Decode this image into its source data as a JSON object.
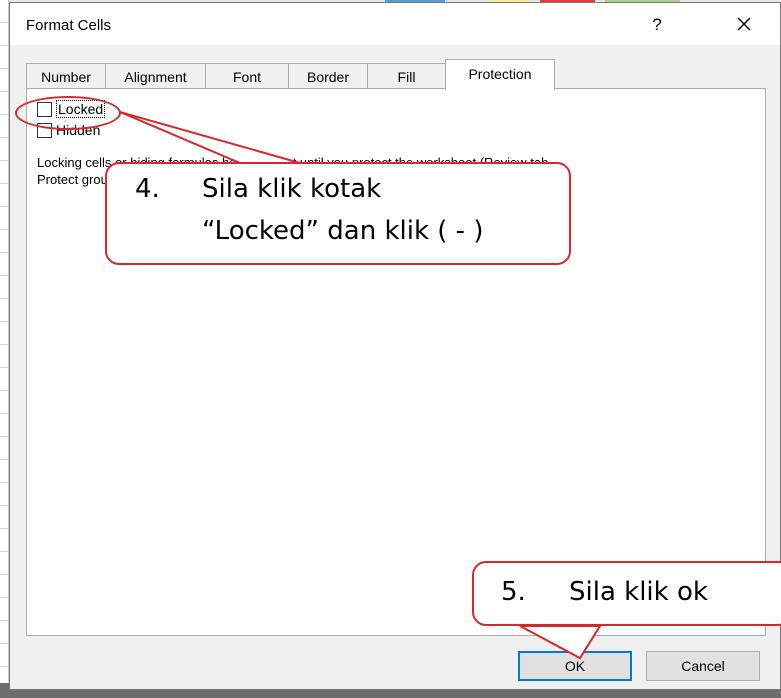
{
  "dialog": {
    "title": "Format Cells",
    "help_label": "?",
    "tabs": [
      {
        "label": "Number"
      },
      {
        "label": "Alignment"
      },
      {
        "label": "Font"
      },
      {
        "label": "Border"
      },
      {
        "label": "Fill"
      },
      {
        "label": "Protection",
        "active": true
      }
    ],
    "locked": {
      "label": "Locked",
      "checked": false
    },
    "hidden": {
      "label": "Hidden",
      "checked": false
    },
    "info_line1": "Locking cells or hiding formulas has no effect until you protect the worksheet (Review tab,",
    "info_line2": "Protect group, Protect Sheet button).",
    "ok_label": "OK",
    "cancel_label": "Cancel"
  },
  "annotations": {
    "callout1_num": "4.",
    "callout1_line1": "Sila klik kotak",
    "callout1_line2": "“Locked” dan klik ( - )",
    "callout2_num": "5.",
    "callout2_text": "Sila klik ok",
    "accent_color": "#d9272d"
  }
}
